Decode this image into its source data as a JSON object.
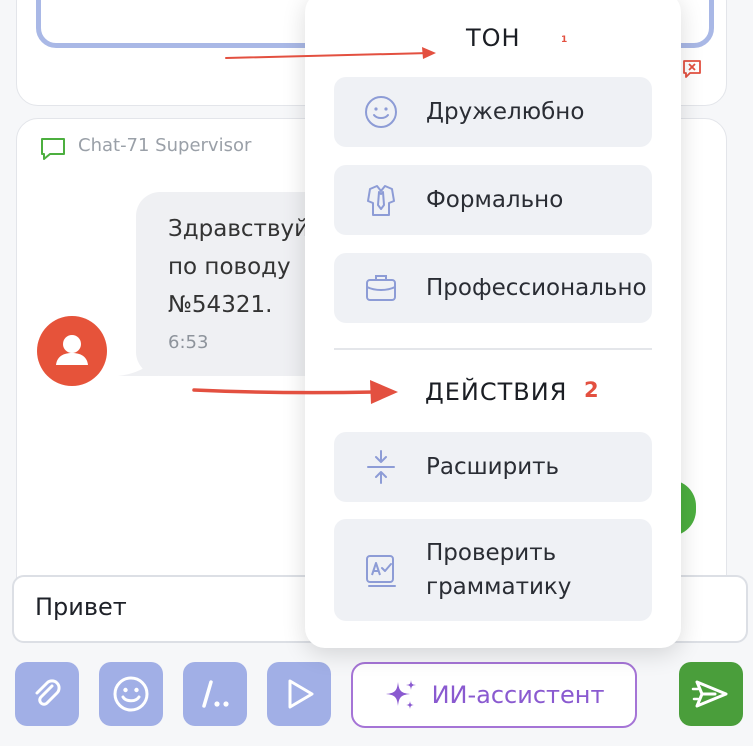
{
  "chat": {
    "sender": "Chat-71 Supervisor",
    "message_text": "Здравствуй\nпо поводу\n№54321.",
    "time": "6:53"
  },
  "composer": {
    "input_value": "Привет"
  },
  "toolbar": {
    "ai_label": "ИИ-ассистент"
  },
  "menu": {
    "tone_header": "ТОН",
    "tone_marker": "1",
    "tone_items": [
      "Дружелюбно",
      "Формально",
      "Профессионально"
    ],
    "actions_header": "ДЕЙСТВИЯ",
    "actions_marker": "2",
    "action_items": [
      "Расширить",
      "Проверить\nграмматику"
    ]
  },
  "colors": {
    "accent": "#a1afe6",
    "ai_border": "#a574d6",
    "send": "#4a9e3b",
    "avatar": "#e6533a",
    "annotation": "#e35040"
  },
  "icons": [
    "flag-x-icon",
    "chat-bubble-icon",
    "user-icon",
    "smiley-icon",
    "necktie-icon",
    "briefcase-icon",
    "expand-icon",
    "grammar-icon",
    "paperclip-icon",
    "emoji-icon",
    "slash-commands-icon",
    "play-icon",
    "sparkle-icon",
    "send-icon"
  ]
}
